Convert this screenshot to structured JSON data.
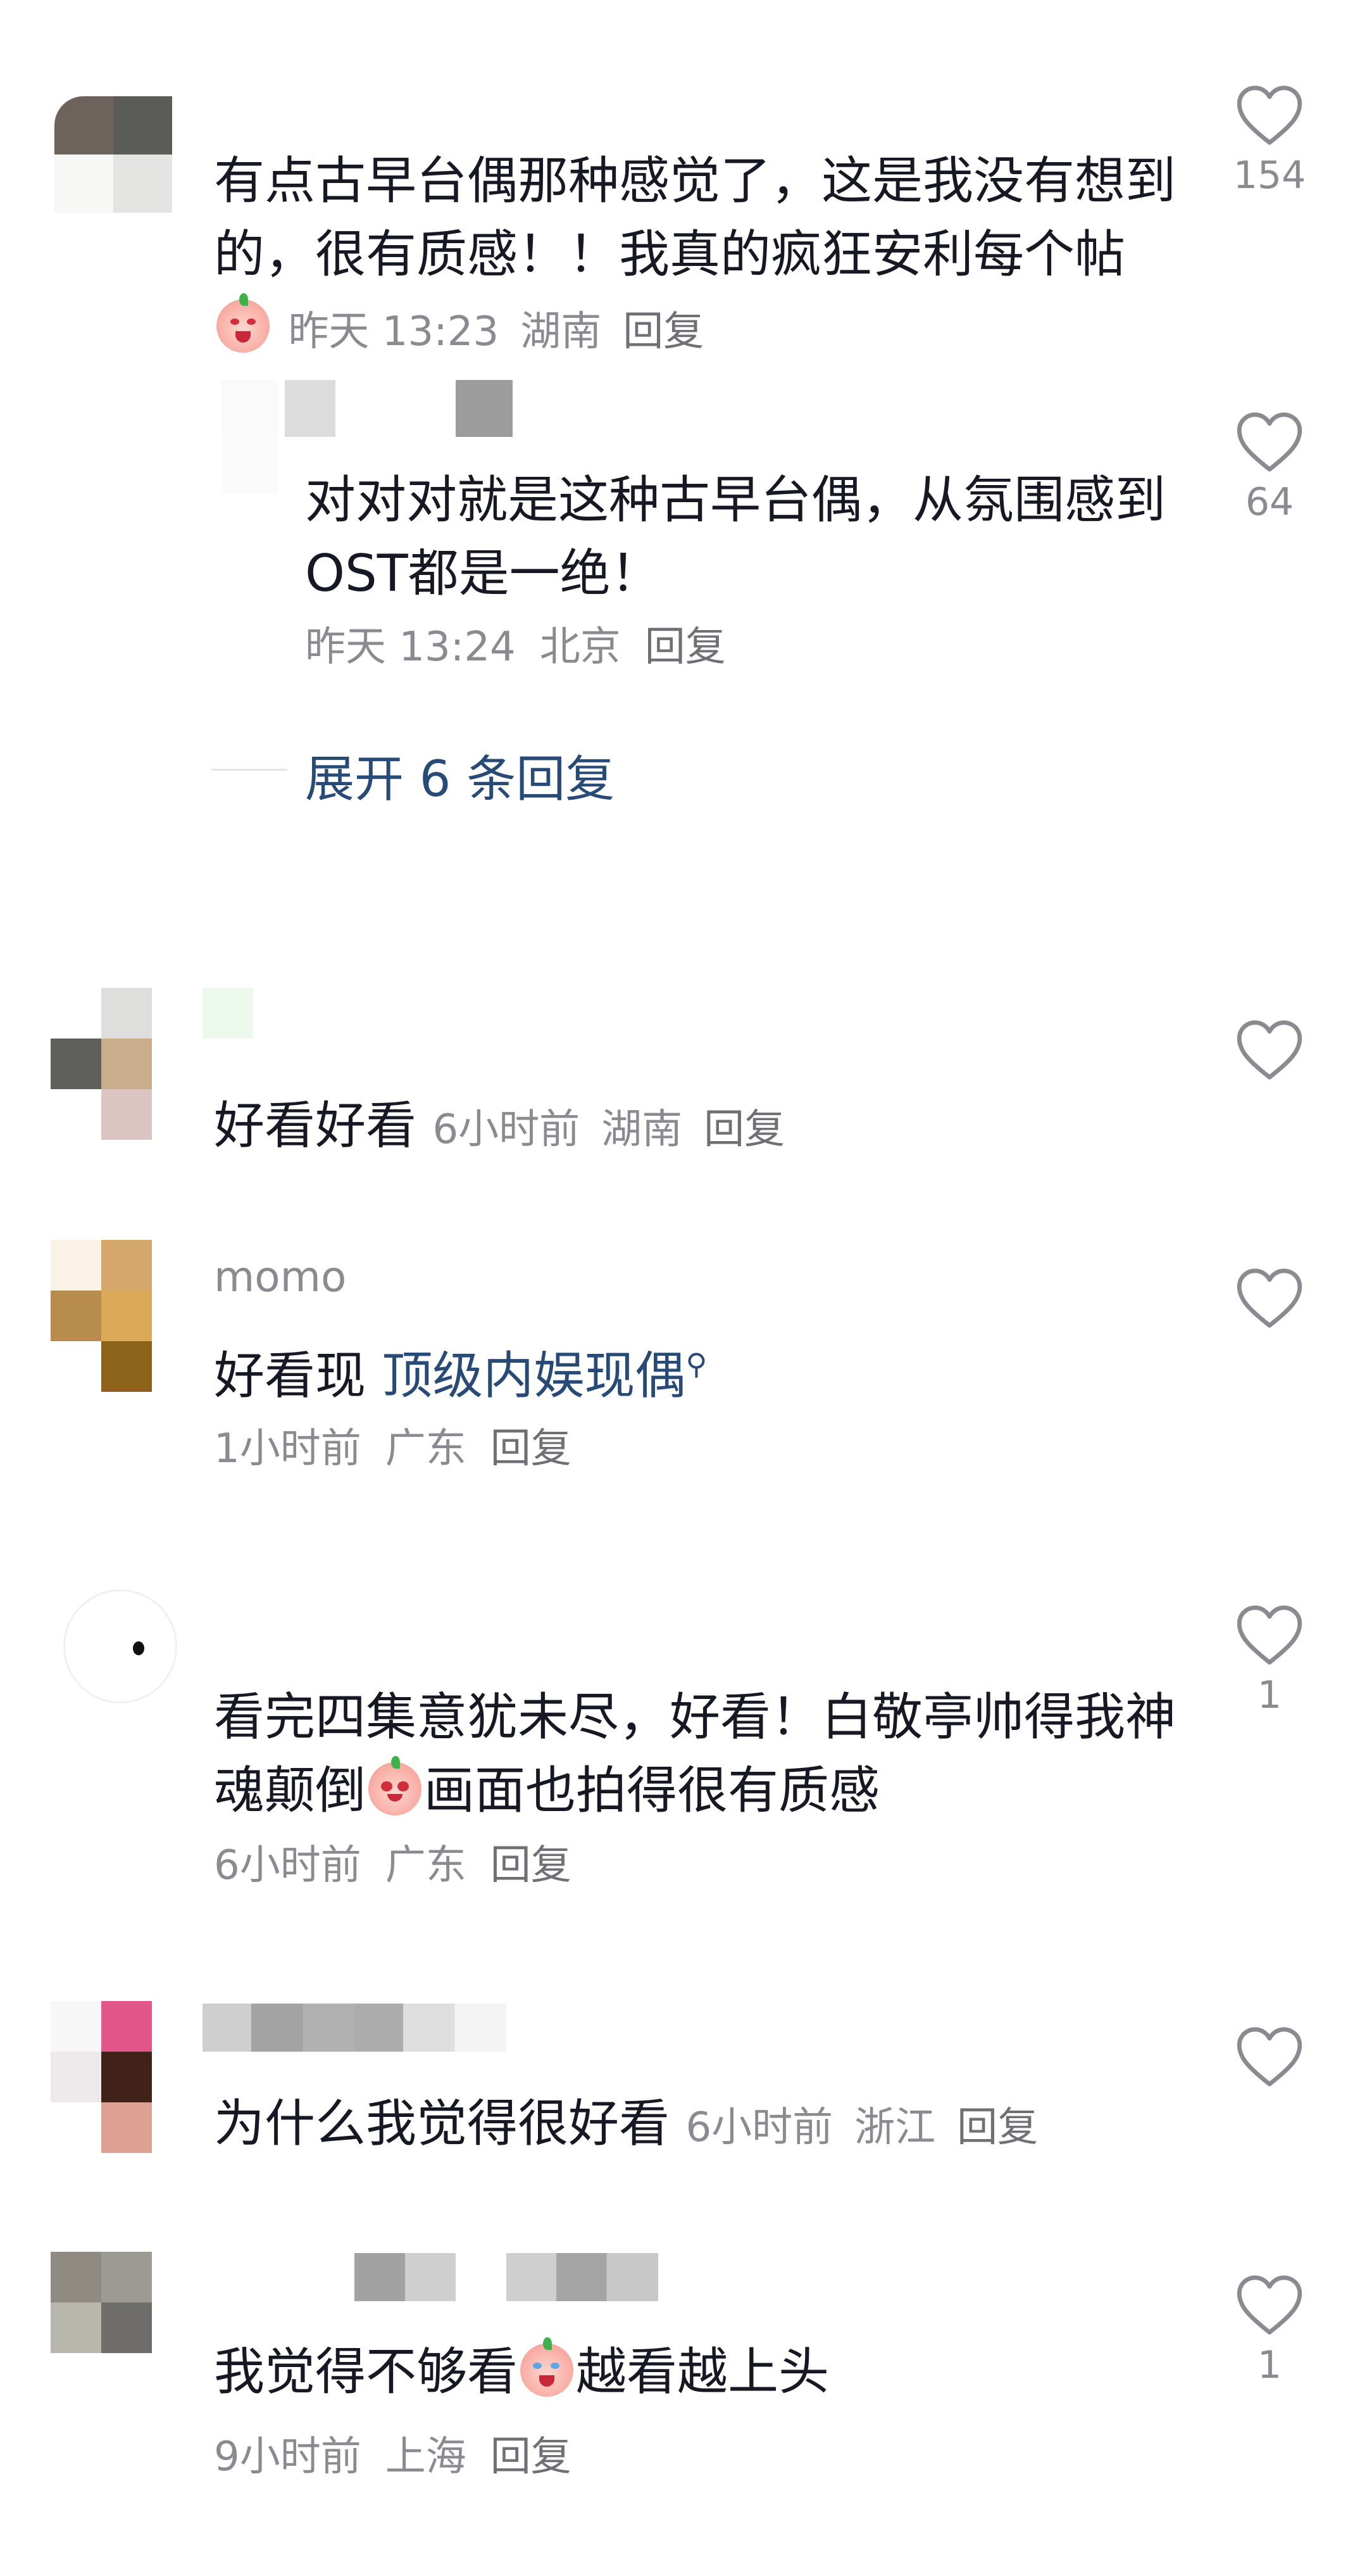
{
  "comments": [
    {
      "text": "有点古早台偶那种感觉了，这是我没有想到的，很有质感！！我真的疯狂安利每个帖",
      "time": "昨天 13:23",
      "location": "湖南",
      "reply": "回复",
      "likes": "154",
      "emoji": "angry-peach-emoji"
    },
    {
      "text": "对对对就是这种古早台偶，从氛围感到OST都是一绝！",
      "time": "昨天 13:24",
      "location": "北京",
      "reply": "回复",
      "likes": "64"
    },
    {
      "expand_label": "展开 6 条回复"
    },
    {
      "text": "好看好看",
      "time": "6小时前",
      "location": "湖南",
      "reply": "回复"
    },
    {
      "username": "momo",
      "text_prefix": "好看现",
      "mention": "顶级内娱现偶",
      "time": "1小时前",
      "location": "广东",
      "reply": "回复"
    },
    {
      "text_part1": "看完四集意犹未尽，好看！白敬亭帅得我神魂颠倒",
      "text_part2": "画面也拍得很有质感",
      "time": "6小时前",
      "location": "广东",
      "reply": "回复",
      "likes": "1",
      "emoji": "heart-eyes-peach-emoji"
    },
    {
      "text": "为什么我觉得很好看",
      "time": "6小时前",
      "location": "浙江",
      "reply": "回复"
    },
    {
      "text_part1": "我觉得不够看",
      "text_part2": "越看越上头",
      "time": "9小时前",
      "location": "上海",
      "reply": "回复",
      "likes": "1",
      "emoji": "crying-peach-emoji"
    }
  ]
}
